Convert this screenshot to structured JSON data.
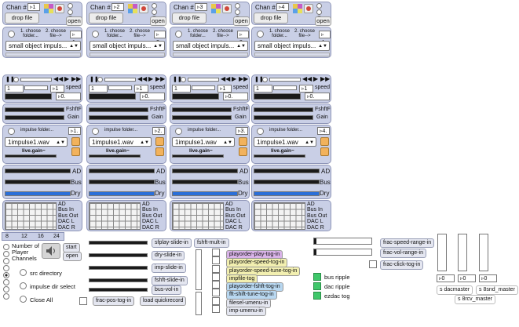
{
  "strip": {
    "chan_label": "Chan #",
    "drop_file": "drop file",
    "open": "open",
    "choose_folder": "1. choose folder...",
    "choose_file": "2. choose file-->",
    "menu_value": "small object impuls...",
    "speed": "speed",
    "one": "1",
    "zero": "0.",
    "fshftf": "FshftF",
    "gain": "Gain",
    "impulse_folder": "impulse folder...",
    "impulse_file": "1impulse1.wav",
    "live_gain": "live.gain~",
    "ad": "AD",
    "bus": "Bus",
    "dry": "Dry",
    "dac_labels": [
      "AD",
      "Bus In",
      "Bus Out",
      "DAC  L",
      "DAC  R"
    ]
  },
  "strips": [
    {
      "chan": "1",
      "chan_display": "▹1",
      "idx": "▹1.",
      "idx2": "▹ 1."
    },
    {
      "chan": "2",
      "chan_display": "▹2",
      "idx": "▹2.",
      "idx2": "▹ 2."
    },
    {
      "chan": "3",
      "chan_display": "▹3",
      "idx": "▹3.",
      "idx2": "▹ 3."
    },
    {
      "chan": "4",
      "chan_display": "▹4",
      "idx": "▹4.",
      "idx2": "▹ 4."
    }
  ],
  "bottom": {
    "tabs": [
      "8",
      "12",
      "16",
      "24"
    ],
    "player_label": "Number of Player Channels",
    "start": "start",
    "open": "open",
    "src_directory": "src directory",
    "impulse_dir_select": "impulse dir select",
    "close_all": "Close All",
    "frac_pos_tog_in": "frac-pos-tog-in",
    "load_quickrecord": "load quickrecord",
    "sliders": [
      "sfplay-slide-in",
      "dry-slide-in",
      "imp-slide-in",
      "fshft-slide-in",
      "bus-vol-in"
    ],
    "fshft_mult_in": "fshft-mult-in",
    "playorder": [
      {
        "label": "playorder-play-tog-in",
        "color": "#d9b3e8"
      },
      {
        "label": "playorder-speed-tog-in",
        "color": "#f2efb0"
      },
      {
        "label": "playorder-speed-tune-tog-in",
        "color": "#f2efb0"
      },
      {
        "label": "impfile-tog",
        "color": "#f2efb0"
      },
      {
        "label": "playorder-fshft-tog-in",
        "color": "#b8d7f0"
      },
      {
        "label": "fft-shift-tune-tog-in",
        "color": "#b8d7f0"
      },
      {
        "label": "filesel-umenu-in",
        "color": "#e4e6f0"
      },
      {
        "label": "imp-umenu-in",
        "color": "#e4e6f0"
      }
    ],
    "bus_ripple": "bus ripple",
    "dac_ripple": "dac ripple",
    "ezdac_tog": "ezdac tog",
    "frac_speed_range_in": "frac-speed-range-in",
    "frac_vol_range_in": "frac-vol-range-in",
    "frac_click_tog_in": "frac-click-tog-in",
    "master_vals": [
      "▹0",
      "▹0",
      "▹0"
    ],
    "s_dacmaster": "s dacmaster",
    "s_8snd_master": "s 8snd_master",
    "s_8rcv_master": "s 8rcv_master"
  },
  "colors": {
    "panel": "#c9cfe6",
    "accent_orange": "#f2b25c",
    "record_red": "#d0473a",
    "blue": "#2b6fd8",
    "green": "#3fc76a"
  }
}
